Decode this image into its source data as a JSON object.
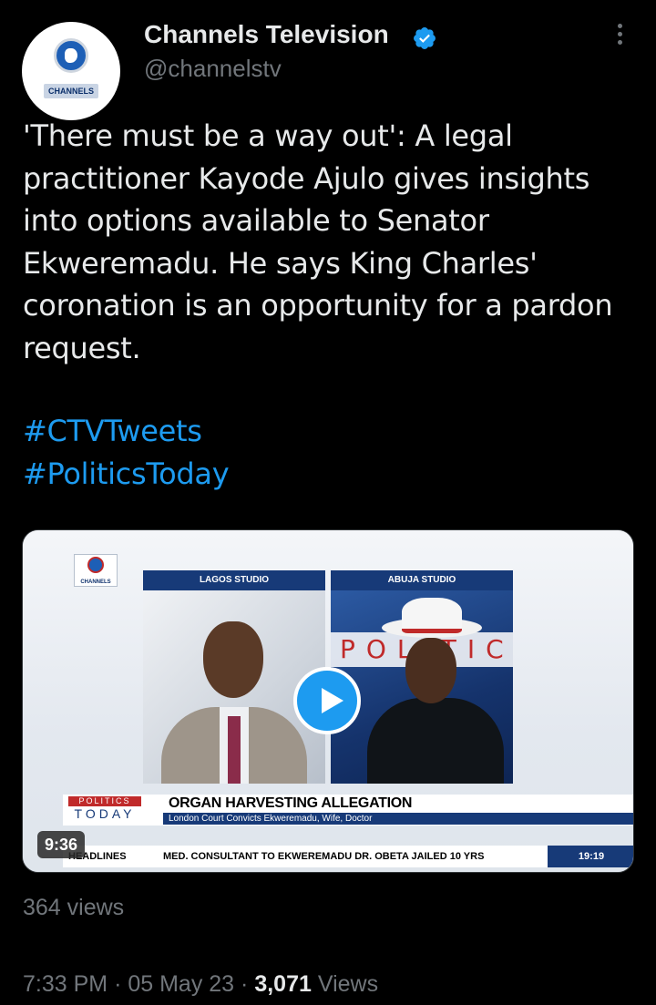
{
  "account": {
    "name": "Channels Television",
    "handle": "@channelstv",
    "avatar_text": "CHANNELS",
    "verified_color": "#1d9bf0"
  },
  "tweet": {
    "text": "'There must be a way out': A legal practitioner Kayode Ajulo gives insights into options available to Senator Ekweremadu. He says King Charles' coronation is an opportunity for a pardon request.",
    "hashtags": [
      "#CTVTweets",
      "#PoliticsToday"
    ]
  },
  "video": {
    "logo_text": "CHANNELS",
    "panel_left_label": "LAGOS STUDIO",
    "panel_right_label": "ABUJA STUDIO",
    "studio_sign": "POLITIC",
    "show_badge_top": "POLITICS",
    "show_badge_bottom": "TODAY",
    "headline": "ORGAN HARVESTING ALLEGATION",
    "subheadline": "London Court Convicts Ekweremadu, Wife, Doctor",
    "ticker_label": "HEADLINES",
    "ticker_text": "MED. CONSULTANT TO EKWEREMADU DR. OBETA JAILED 10 YRS",
    "ticker_time": "19:19",
    "duration": "9:36"
  },
  "stats": {
    "video_views": "364 views",
    "time": "7:33 PM",
    "date": "05 May 23",
    "views_number": "3,071",
    "views_label": "Views"
  }
}
